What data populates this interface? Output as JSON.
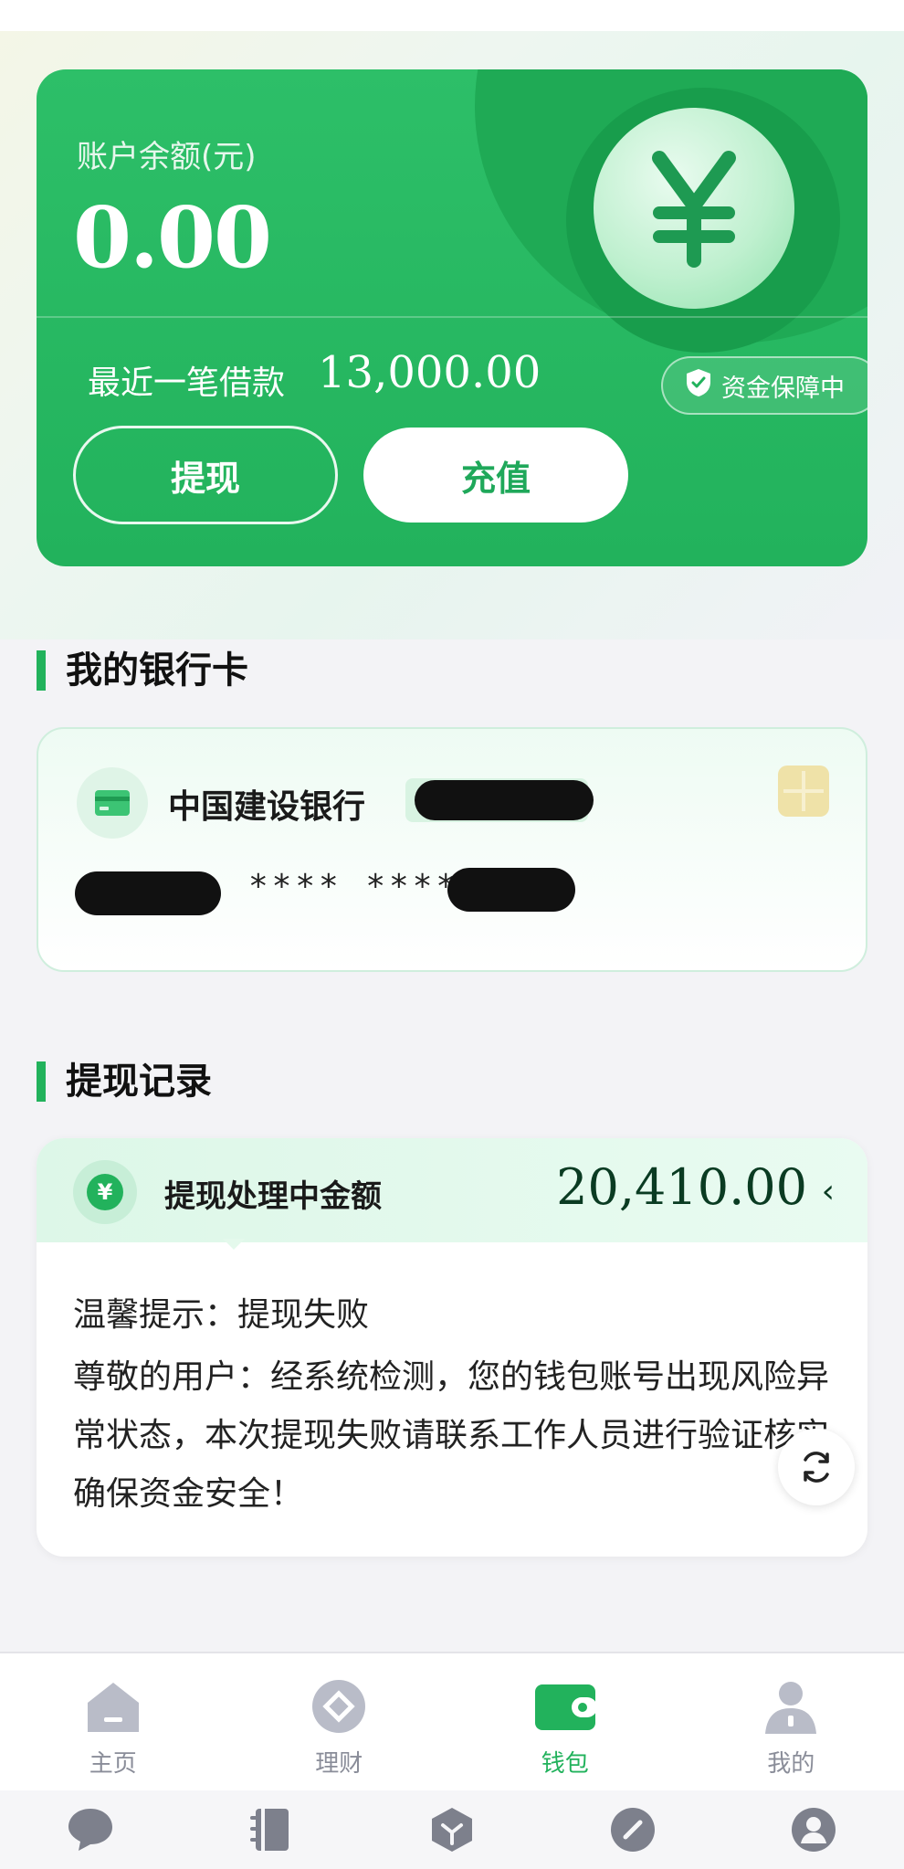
{
  "balance": {
    "label": "账户余额(元)",
    "amount": "0.00",
    "recent_loan_label": "最近一笔借款",
    "recent_loan_value": "13,000.00",
    "safety_badge": "资金保障中",
    "withdraw_label": "提现",
    "recharge_label": "充值",
    "coin_icon": "yen-icon"
  },
  "bank_section": {
    "title": "我的银行卡",
    "bank_name": "中国建设银行",
    "card_number_masked": "**** ****",
    "icons": [
      "card-icon",
      "chip-icon"
    ]
  },
  "record_section": {
    "title": "提现记录",
    "head_title": "提现处理中金额",
    "amount": "20,410.00",
    "chevron": "‹",
    "tip_title": "温馨提示：提现失败",
    "tip_body": "尊敬的用户：经系统检测，您的钱包账号出现风险异常状态，本次提现失败请联系工作人员进行验证核实确保资金安全！"
  },
  "tabbar": {
    "items": [
      {
        "label": "主页",
        "icon": "home-icon"
      },
      {
        "label": "理财",
        "icon": "finance-icon"
      },
      {
        "label": "钱包",
        "icon": "wallet-icon",
        "active": true
      },
      {
        "label": "我的",
        "icon": "profile-icon"
      }
    ]
  },
  "system_bar": {
    "icons": [
      "chat-icon",
      "book-icon",
      "cube-icon",
      "compass-icon",
      "user-circle-icon"
    ]
  },
  "colors": {
    "accent": "#22b25c",
    "card_green": "#2dbf68",
    "dark_amount": "#0a3b22"
  }
}
